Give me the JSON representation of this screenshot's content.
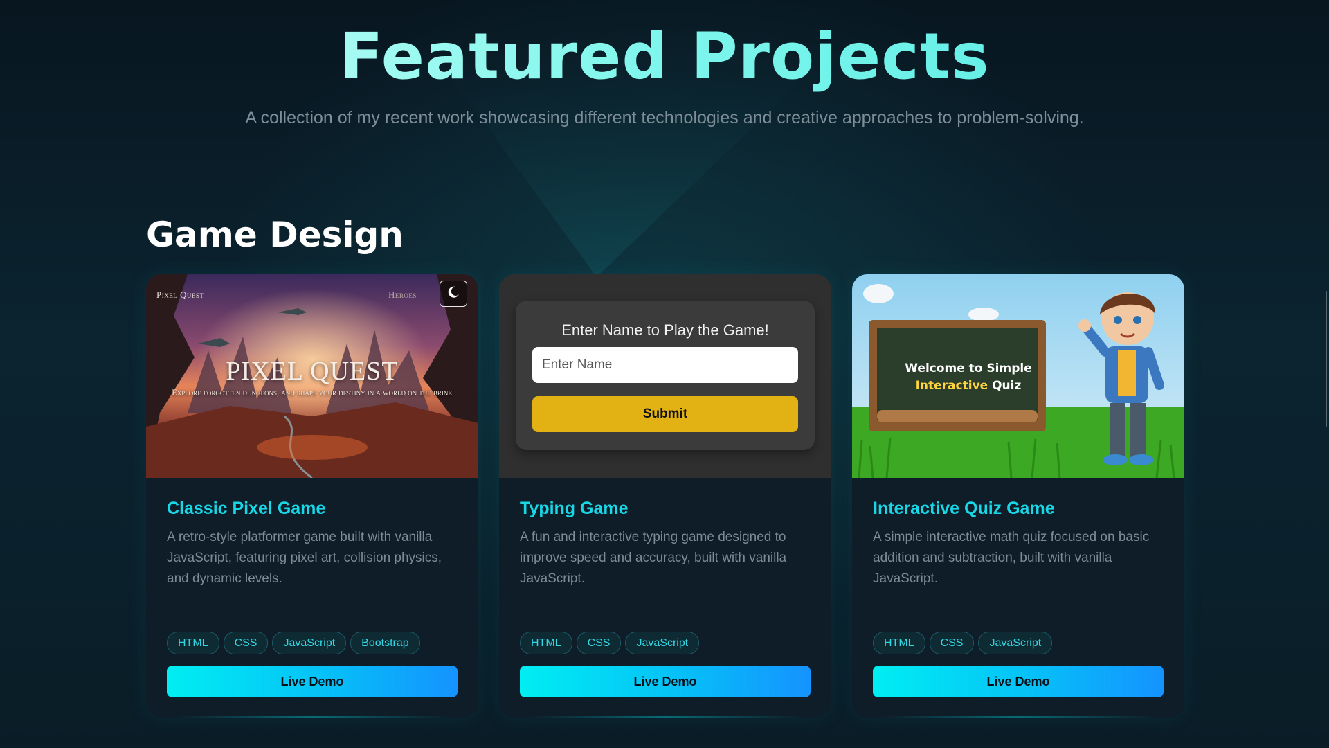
{
  "header": {
    "title": "Featured Projects",
    "subtitle": "A collection of my recent work showcasing different technologies and creative approaches to problem-solving."
  },
  "section": {
    "title": "Game Design"
  },
  "projects": [
    {
      "title": "Classic Pixel Game",
      "description": "A retro-style platformer game built with vanilla JavaScript, featuring pixel art, collision physics, and dynamic levels.",
      "tags": [
        "HTML",
        "CSS",
        "JavaScript",
        "Bootstrap"
      ],
      "button": "Live Demo",
      "preview": {
        "logo": "Pixel Quest",
        "nav": "Heroes",
        "headline": "PIXEL QUEST",
        "tagline": "Explore forgotten dungeons, and shape your destiny in a world on the brink",
        "theme_icon": "moon-icon"
      }
    },
    {
      "title": "Typing Game",
      "description": "A fun and interactive typing game designed to improve speed and accuracy, built with vanilla JavaScript.",
      "tags": [
        "HTML",
        "CSS",
        "JavaScript"
      ],
      "button": "Live Demo",
      "preview": {
        "heading": "Enter Name to Play the Game!",
        "placeholder": "Enter Name",
        "submit": "Submit"
      }
    },
    {
      "title": "Interactive Quiz Game",
      "description": "A simple interactive math quiz focused on basic addition and subtraction, built with vanilla JavaScript.",
      "tags": [
        "HTML",
        "CSS",
        "JavaScript"
      ],
      "button": "Live Demo",
      "preview": {
        "board_line1": "Welcome to Simple",
        "board_highlight": "Interactive",
        "board_word": "Quiz"
      }
    }
  ],
  "colors": {
    "accent": "#18d8e8",
    "button_gradient_start": "#00eef2",
    "button_gradient_end": "#1593ff",
    "submit": "#e2b215"
  }
}
